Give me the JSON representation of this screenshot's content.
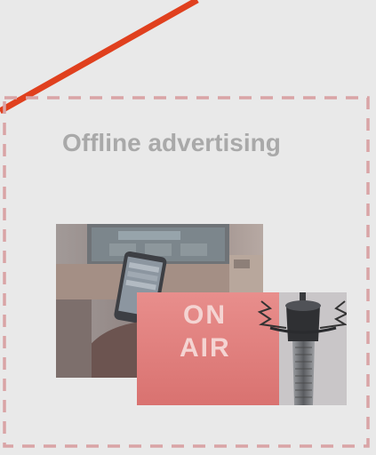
{
  "section": {
    "title": "Offline advertising"
  },
  "images": [
    {
      "name": "tv-remote-phone-photo",
      "description_icon": "photo-icon"
    },
    {
      "name": "on-air-microphone-photo",
      "sign_text": "ON AIR",
      "description_icon": "microphone-icon"
    }
  ],
  "colors": {
    "background": "#e9e9e9",
    "accent_line": "#e0401e",
    "dashed_border": "#d9a4a6",
    "title": "#a9a9a9"
  }
}
